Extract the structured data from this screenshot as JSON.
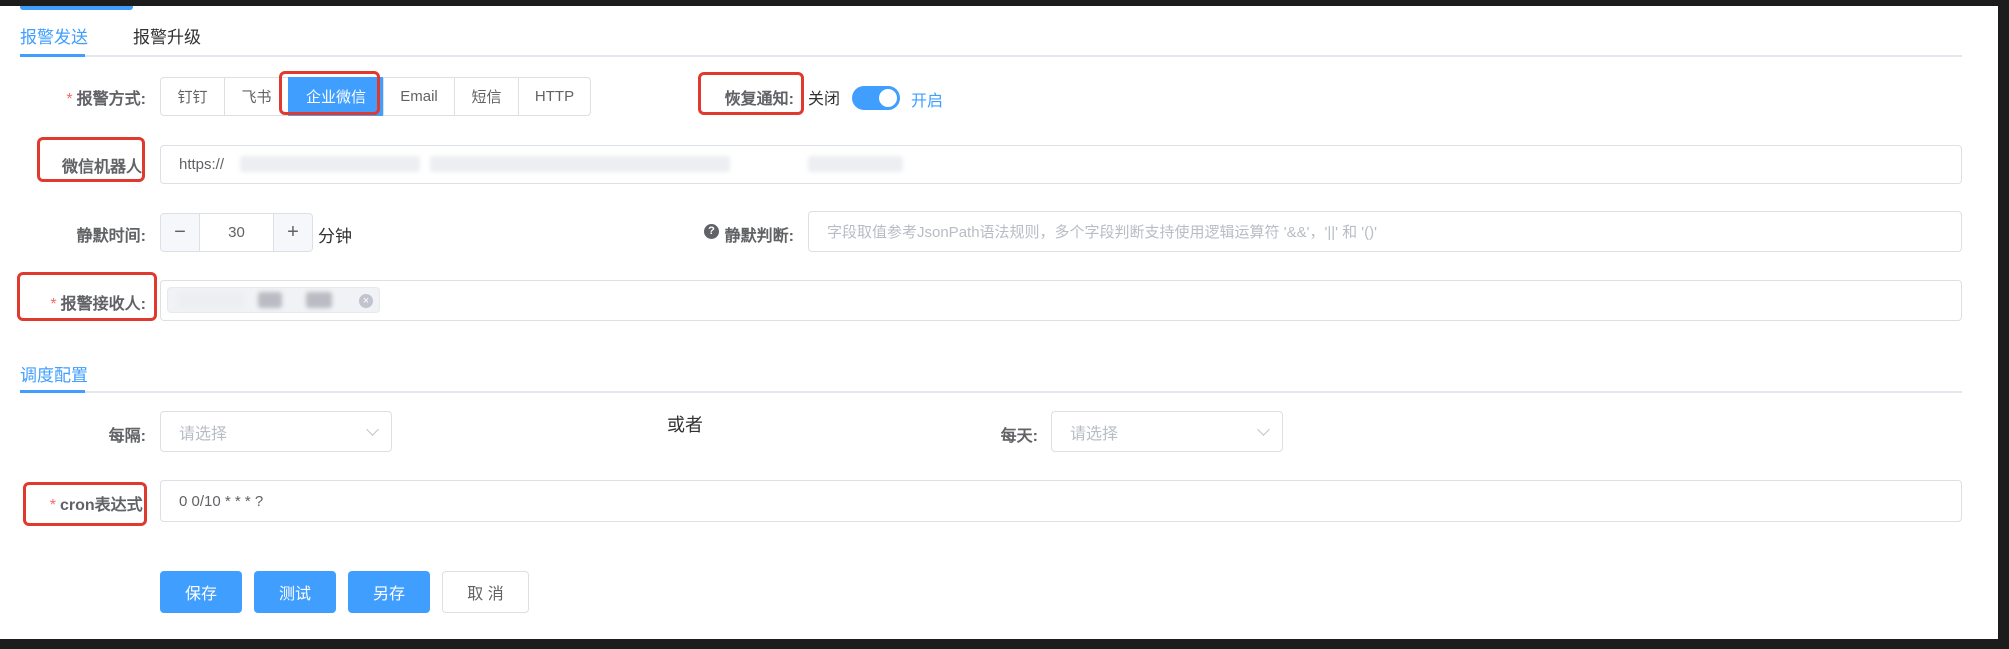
{
  "tabs": [
    {
      "label": "报警发送",
      "active": true
    },
    {
      "label": "报警升级",
      "active": false
    }
  ],
  "alert": {
    "method_label": "报警方式:",
    "methods": [
      "钉钉",
      "飞书",
      "企业微信",
      "Email",
      "短信",
      "HTTP"
    ],
    "selected_method": "企业微信",
    "recovery_label": "恢复通知:",
    "recovery_off": "关闭",
    "recovery_on": "开启",
    "recovery_enabled": true
  },
  "robot": {
    "label": "微信机器人",
    "value": "https://"
  },
  "silence": {
    "label": "静默时间:",
    "value": "30",
    "unit": "分钟",
    "minus": "−",
    "plus": "+",
    "judge_label": "静默判断:",
    "judge_placeholder": "字段取值参考JsonPath语法规则，多个字段判断支持使用逻辑运算符 '&&'，'||' 和 '()'",
    "help_glyph": "?"
  },
  "receiver": {
    "label": "报警接收人:",
    "close_glyph": "×"
  },
  "schedule": {
    "section_label": "调度配置",
    "every_label": "每隔:",
    "every_placeholder": "请选择",
    "or_text": "或者",
    "daily_label": "每天:",
    "daily_placeholder": "请选择",
    "cron_label": "cron表达式:",
    "cron_value": "0 0/10 * * * ?"
  },
  "buttons": {
    "save": "保存",
    "test": "测试",
    "save_as": "另存",
    "cancel": "取 消"
  },
  "colors": {
    "accent": "#409eff",
    "required": "#f56c6c",
    "highlight": "#e03a2f"
  }
}
